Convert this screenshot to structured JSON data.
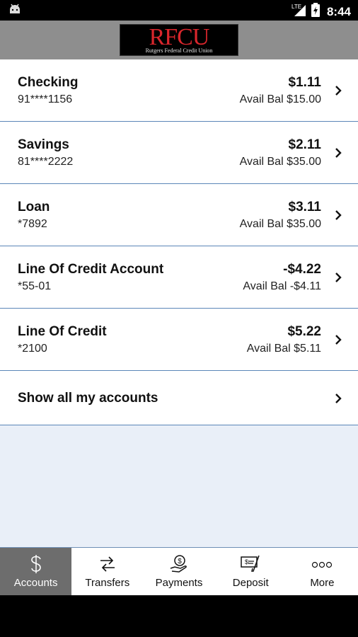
{
  "status_bar": {
    "network": "LTE",
    "time": "8:44"
  },
  "header": {
    "logo_text": "RFCU",
    "logo_subtext": "Rutgers Federal Credit Union",
    "brand_color": "#d9262c"
  },
  "accounts": [
    {
      "name": "Checking",
      "number": "91****1156",
      "balance": "$1.11",
      "avail": "Avail Bal $15.00"
    },
    {
      "name": "Savings",
      "number": "81****2222",
      "balance": "$2.11",
      "avail": "Avail Bal $35.00"
    },
    {
      "name": "Loan",
      "number": "*7892",
      "balance": "$3.11",
      "avail": "Avail Bal $35.00"
    },
    {
      "name": "Line Of Credit Account",
      "number": "*55-01",
      "balance": "-$4.22",
      "avail": "Avail Bal -$4.11"
    },
    {
      "name": "Line Of Credit",
      "number": "*2100",
      "balance": "$5.22",
      "avail": "Avail Bal $5.11"
    }
  ],
  "show_all_label": "Show all my accounts",
  "tabs": [
    {
      "label": "Accounts",
      "icon": "dollar-icon",
      "active": true
    },
    {
      "label": "Transfers",
      "icon": "transfer-arrows-icon",
      "active": false
    },
    {
      "label": "Payments",
      "icon": "hand-coin-icon",
      "active": false
    },
    {
      "label": "Deposit",
      "icon": "check-deposit-icon",
      "active": false
    },
    {
      "label": "More",
      "icon": "more-dots-icon",
      "active": false
    }
  ],
  "colors": {
    "separator": "#5b86b8",
    "background": "#e9eff8",
    "active_tab": "#6d6d6d"
  }
}
